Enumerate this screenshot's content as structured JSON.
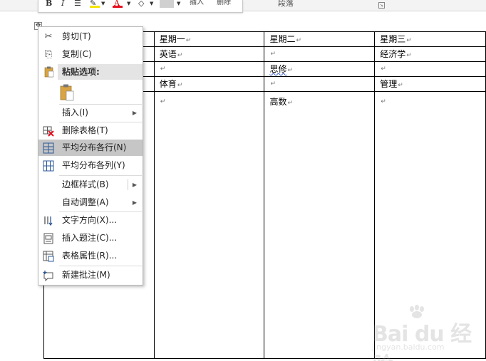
{
  "ribbon": {
    "bold": "B",
    "italic": "I",
    "insert_label": "插入",
    "delete_label": "删除",
    "paragraph_group": "段落",
    "highlight_color": "#f5e400",
    "font_color": "#e81123"
  },
  "table": {
    "rows": [
      [
        "",
        "星期一",
        "星期二",
        "星期三"
      ],
      [
        "",
        "英语",
        "",
        "经济学"
      ],
      [
        "",
        "",
        "思修",
        ""
      ],
      [
        "",
        "体育",
        "",
        "管理"
      ],
      [
        "",
        "",
        "高数",
        ""
      ]
    ]
  },
  "context_menu": {
    "cut": "剪切(T)",
    "copy": "复制(C)",
    "paste_options": "粘贴选项:",
    "insert": "插入(I)",
    "delete_table": "删除表格(T)",
    "distribute_rows": "平均分布各行(N)",
    "distribute_columns": "平均分布各列(Y)",
    "border_styles": "边框样式(B)",
    "autofit": "自动调整(A)",
    "text_direction": "文字方向(X)...",
    "insert_caption": "插入题注(C)...",
    "table_properties": "表格属性(R)...",
    "new_comment": "新建批注(M)",
    "hovered_item": "distribute_rows"
  },
  "watermark": {
    "logo_text": "Bai du 经验",
    "url": "jingyan.baidu.com"
  }
}
